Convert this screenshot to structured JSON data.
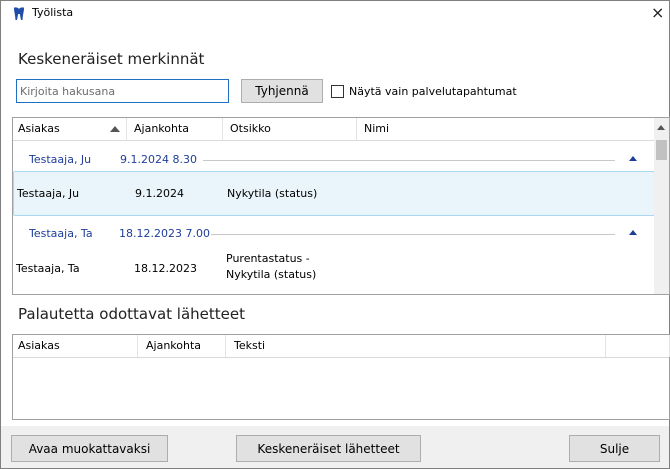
{
  "window": {
    "title": "Työlista",
    "close_glyph": "×"
  },
  "section1": {
    "title": "Keskeneräiset merkinnät"
  },
  "search": {
    "placeholder": "Kirjoita hakusana",
    "value": ""
  },
  "clear_button": {
    "label": "Tyhjennä"
  },
  "checkbox": {
    "label": "Näytä vain palvelutapahtumat",
    "checked": false
  },
  "grid1": {
    "columns": [
      "Asiakas",
      "Ajankohta",
      "Otsikko",
      "Nimi"
    ],
    "groups": [
      {
        "label_name": "Testaaja, Ju",
        "label_date": "9.1.2024 8.30",
        "rows": [
          {
            "asiakas": "Testaaja, Ju",
            "ajankohta": "9.1.2024",
            "otsikko": "Nykytila (status)",
            "nimi": ""
          }
        ]
      },
      {
        "label_name": "Testaaja, Ta",
        "label_date": "18.12.2023 7.00",
        "rows": [
          {
            "asiakas": "Testaaja, Ta",
            "ajankohta": "18.12.2023",
            "otsikko_line1": "Purentastatus -",
            "otsikko_line2": "Nykytila (status)",
            "nimi": ""
          }
        ]
      }
    ]
  },
  "section2": {
    "title": "Palautetta odottavat lähetteet"
  },
  "grid2": {
    "columns": [
      "Asiakas",
      "Ajankohta",
      "Teksti",
      ""
    ]
  },
  "buttons": {
    "edit": "Avaa muokattavaksi",
    "referrals": "Keskeneräiset lähetteet",
    "close": "Sulje"
  },
  "icons": {
    "app": "tooth-icon",
    "sort": "sort-ascending-icon",
    "collapse": "chevron-up-icon"
  },
  "colors": {
    "group_text": "#1f3e9a",
    "selected_row": "#eaf5fb",
    "focus_border": "#1f6fc4"
  }
}
